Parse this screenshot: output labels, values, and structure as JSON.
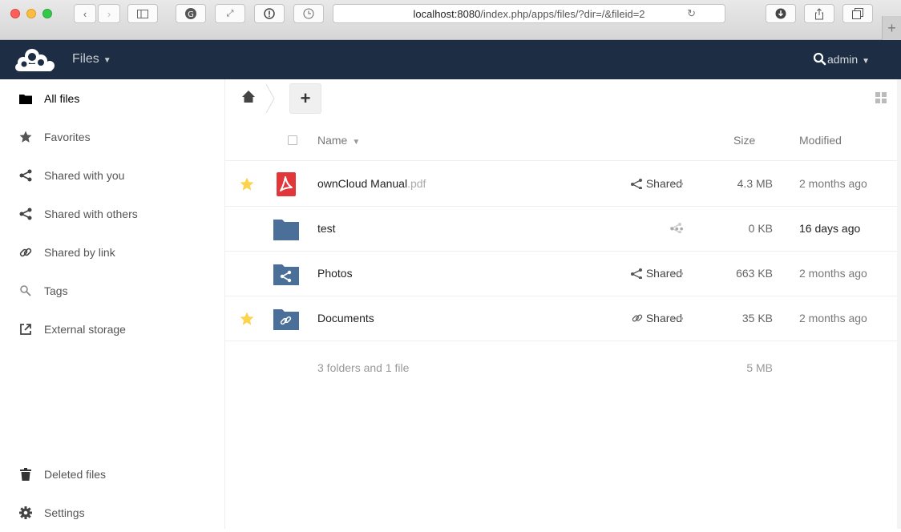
{
  "browser": {
    "url_host": "localhost:8080",
    "url_path": "/index.php/apps/files/?dir=/&fileid=2"
  },
  "header": {
    "app_name": "Files",
    "user": "admin"
  },
  "sidebar": {
    "items": [
      {
        "label": "All files",
        "icon": "folder-icon"
      },
      {
        "label": "Favorites",
        "icon": "star-icon"
      },
      {
        "label": "Shared with you",
        "icon": "share-icon"
      },
      {
        "label": "Shared with others",
        "icon": "share-icon"
      },
      {
        "label": "Shared by link",
        "icon": "link-icon"
      },
      {
        "label": "Tags",
        "icon": "tag-search-icon"
      },
      {
        "label": "External storage",
        "icon": "external-icon"
      }
    ],
    "bottom": [
      {
        "label": "Deleted files",
        "icon": "trash-icon"
      },
      {
        "label": "Settings",
        "icon": "gear-icon"
      }
    ]
  },
  "controls": {
    "add_label": "+"
  },
  "table": {
    "headers": {
      "name": "Name",
      "size": "Size",
      "modified": "Modified"
    },
    "rows": [
      {
        "name": "ownCloud Manual",
        "ext": ".pdf",
        "share": "Shared",
        "size": "4.3 MB",
        "modified": "2 months ago",
        "favorite": true,
        "type": "pdf"
      },
      {
        "name": "test",
        "ext": "",
        "share": "",
        "size": "0 KB",
        "modified": "16 days ago",
        "favorite": false,
        "type": "folder"
      },
      {
        "name": "Photos",
        "ext": "",
        "share": "Shared",
        "size": "663 KB",
        "modified": "2 months ago",
        "favorite": false,
        "type": "shared-folder"
      },
      {
        "name": "Documents",
        "ext": "",
        "share": "Shared",
        "size": "35 KB",
        "modified": "2 months ago",
        "favorite": true,
        "type": "link-folder"
      }
    ],
    "more_label": "•••",
    "summary": {
      "text": "3 folders and 1 file",
      "size": "5 MB"
    }
  },
  "colors": {
    "header_bg": "#1d2d44",
    "folder": "#4a6f98",
    "pdf": "#e2373a",
    "star": "#fcd34d"
  }
}
